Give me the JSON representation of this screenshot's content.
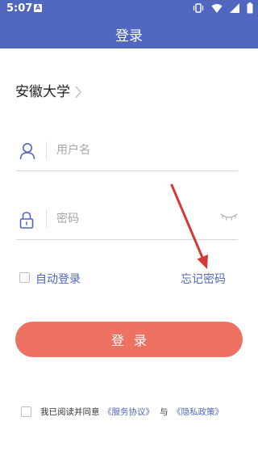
{
  "status_bar": {
    "time": "5:07",
    "notification_glyph": "A",
    "icons": [
      "vibrate-icon",
      "wifi-icon",
      "signal-icon",
      "battery-icon"
    ]
  },
  "header": {
    "title": "登录"
  },
  "school": {
    "name": "安徽大学"
  },
  "username": {
    "placeholder": "用户名",
    "value": ""
  },
  "password": {
    "placeholder": "密码",
    "value": ""
  },
  "options": {
    "auto_login_label": "自动登录",
    "forgot_password_label": "忘记密码"
  },
  "login_button": {
    "label": "登录"
  },
  "agreement": {
    "prefix": "我已阅读并同意",
    "service_link": "《服务协议》",
    "conjunction": "与",
    "privacy_link": "《隐私政策》"
  },
  "colors": {
    "primary": "#5167bf",
    "button": "#ee7261",
    "annotation_arrow": "#d33a35"
  }
}
